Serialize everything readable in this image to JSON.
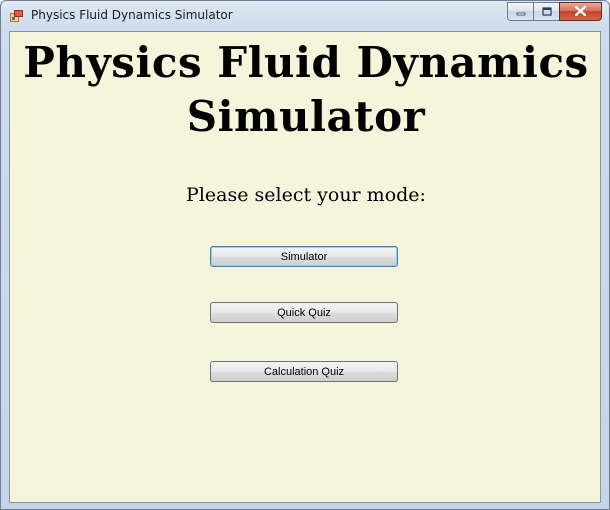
{
  "window": {
    "title": "Physics Fluid Dynamics Simulator"
  },
  "main": {
    "heading_line1": "Physics Fluid Dynamics",
    "heading_line2": "Simulator",
    "prompt": "Please select your mode:",
    "buttons": [
      {
        "label": "Simulator"
      },
      {
        "label": "Quick Quiz"
      },
      {
        "label": "Calculation Quiz"
      }
    ]
  },
  "colors": {
    "client_background": "#f5f5dc",
    "close_button": "#c1432b"
  },
  "icons": {
    "app": "app-window-icon",
    "minimize": "minimize-icon",
    "maximize": "maximize-icon",
    "close": "close-icon"
  }
}
